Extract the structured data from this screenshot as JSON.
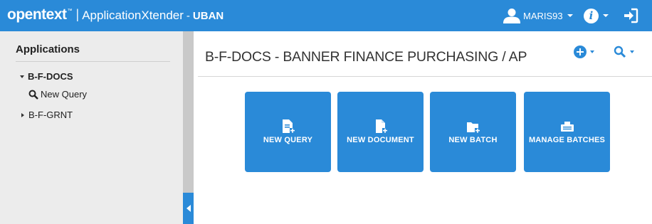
{
  "header": {
    "logo": "opentext",
    "trademark": "™",
    "separator": "|",
    "app_name": "ApplicationXtender",
    "dash": "-",
    "site": "UBAN",
    "user_name": "MARIS93",
    "info_glyph": "i",
    "icons": {
      "user": "user-icon",
      "info": "info-icon",
      "logout": "logout-icon"
    },
    "color": "#2a8ad8"
  },
  "sidebar": {
    "heading": "Applications",
    "items": [
      {
        "label": "B-F-DOCS",
        "state": "expanded"
      },
      {
        "label": "New Query",
        "icon": "search-icon"
      },
      {
        "label": "B-F-GRNT",
        "state": "collapsed"
      }
    ]
  },
  "main": {
    "title": "B-F-DOCS - BANNER FINANCE PURCHASING / AP",
    "toolbar": {
      "add_icon": "add-circle-icon",
      "search_icon": "search-icon"
    },
    "tiles": [
      {
        "label": "NEW QUERY",
        "icon": "new-query-icon"
      },
      {
        "label": "NEW DOCUMENT",
        "icon": "new-document-icon"
      },
      {
        "label": "NEW BATCH",
        "icon": "new-batch-icon"
      },
      {
        "label": "MANAGE BATCHES",
        "icon": "manage-batches-icon"
      }
    ]
  }
}
